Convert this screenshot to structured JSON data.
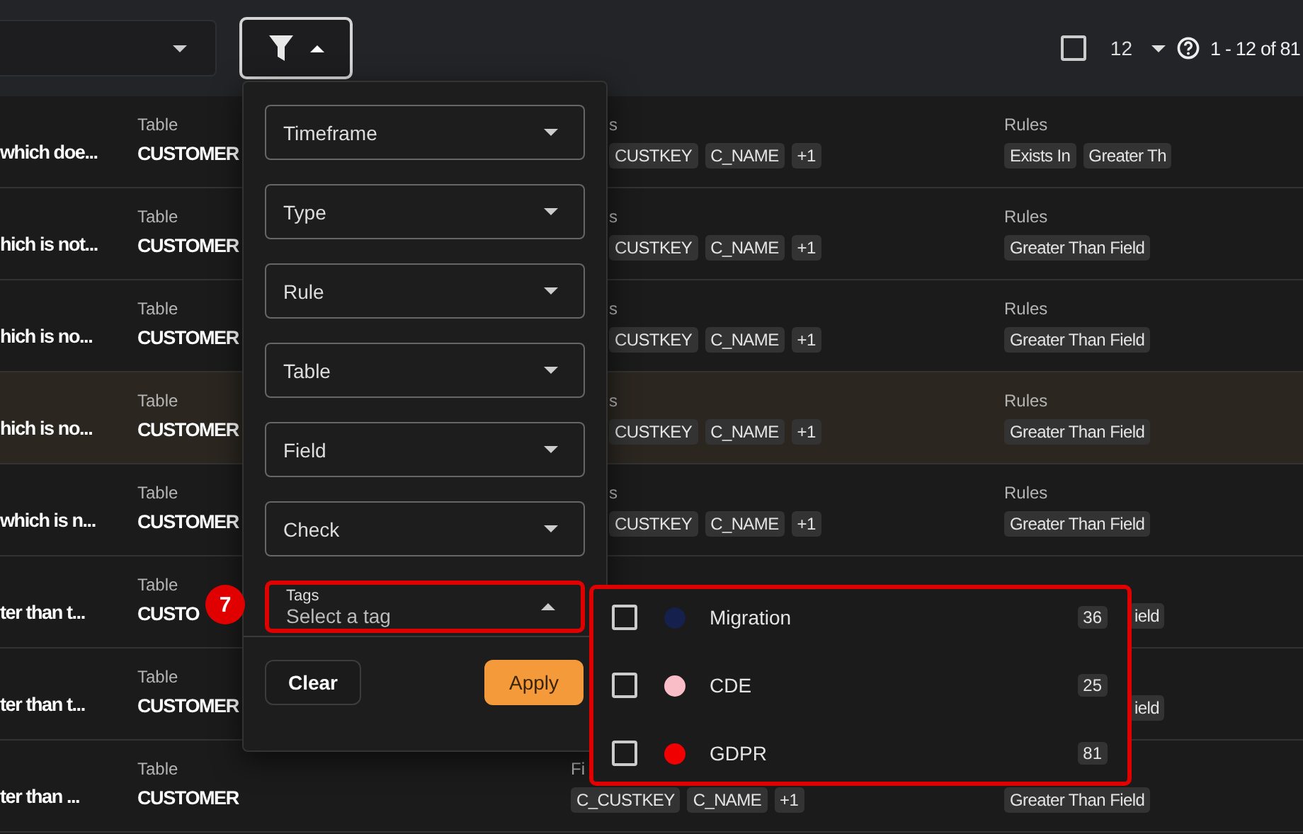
{
  "toolbar": {
    "select_all_checked": false,
    "page_size": "12",
    "range": "1 - 12 of 81",
    "filter_open": true
  },
  "rows": [
    {
      "kind": "behind_filter",
      "highlighted": false,
      "description": "which doe...",
      "table_label": "Table",
      "table": "CUSTOMER",
      "fields_label": "s",
      "fields": [
        "CUSTKEY",
        "C_NAME",
        "+1"
      ],
      "rules_label": "Rules",
      "rules": [
        "Exists In",
        "Greater Th"
      ]
    },
    {
      "kind": "behind_filter",
      "highlighted": false,
      "description": "hich is not...",
      "table_label": "Table",
      "table": "CUSTOMER",
      "fields_label": "s",
      "fields": [
        "CUSTKEY",
        "C_NAME",
        "+1"
      ],
      "rules_label": "Rules",
      "rules": [
        "Greater Than Field"
      ]
    },
    {
      "kind": "behind_filter",
      "highlighted": false,
      "description": "hich is no...",
      "table_label": "Table",
      "table": "CUSTOMER",
      "fields_label": "s",
      "fields": [
        "CUSTKEY",
        "C_NAME",
        "+1"
      ],
      "rules_label": "Rules",
      "rules": [
        "Greater Than Field"
      ]
    },
    {
      "kind": "behind_filter",
      "highlighted": true,
      "description": "hich is no...",
      "table_label": "Table",
      "table": "CUSTOMER",
      "fields_label": "s",
      "fields": [
        "CUSTKEY",
        "C_NAME",
        "+1"
      ],
      "rules_label": "Rules",
      "rules": [
        "Greater Than Field"
      ]
    },
    {
      "kind": "behind_filter",
      "highlighted": false,
      "description": "which is n...",
      "table_label": "Table",
      "table": "CUSTOMER",
      "fields_label": "s",
      "fields": [
        "CUSTKEY",
        "C_NAME",
        "+1"
      ],
      "rules_label": "Rules",
      "rules": [
        "Greater Than Field"
      ]
    },
    {
      "kind": "behind_tags",
      "highlighted": false,
      "description": "ter than t...",
      "table_label": "Table",
      "table": "CUSTO",
      "rules": [
        "ield"
      ]
    },
    {
      "kind": "behind_tags",
      "highlighted": false,
      "description": "ter than t...",
      "table_label": "Table",
      "table": "CUSTOMER",
      "rules": [
        "ield"
      ]
    },
    {
      "kind": "full",
      "highlighted": false,
      "description": "ter than ...",
      "table_label": "Table",
      "table": "CUSTOMER",
      "fields_label": "Fi",
      "fields": [
        "C_CUSTKEY",
        "C_NAME",
        "+1"
      ],
      "rules": [
        "Greater Than Field"
      ]
    }
  ],
  "filter_panel": {
    "selects": [
      {
        "label": "Timeframe"
      },
      {
        "label": "Type"
      },
      {
        "label": "Rule"
      },
      {
        "label": "Table"
      },
      {
        "label": "Field"
      },
      {
        "label": "Check"
      }
    ],
    "tags_field": {
      "label": "Tags",
      "placeholder": "Select a tag",
      "expanded": true,
      "highlighted": true
    },
    "clear_button": "Clear",
    "apply_button": "Apply"
  },
  "step_badge": "7",
  "tag_menu": {
    "highlighted": true,
    "options": [
      {
        "name": "Migration",
        "color": "#16204d",
        "count": "36",
        "checked": false
      },
      {
        "name": "CDE",
        "color": "#f9bdc8",
        "count": "25",
        "checked": false
      },
      {
        "name": "GDPR",
        "color": "#f00000",
        "count": "81",
        "checked": false
      }
    ]
  }
}
